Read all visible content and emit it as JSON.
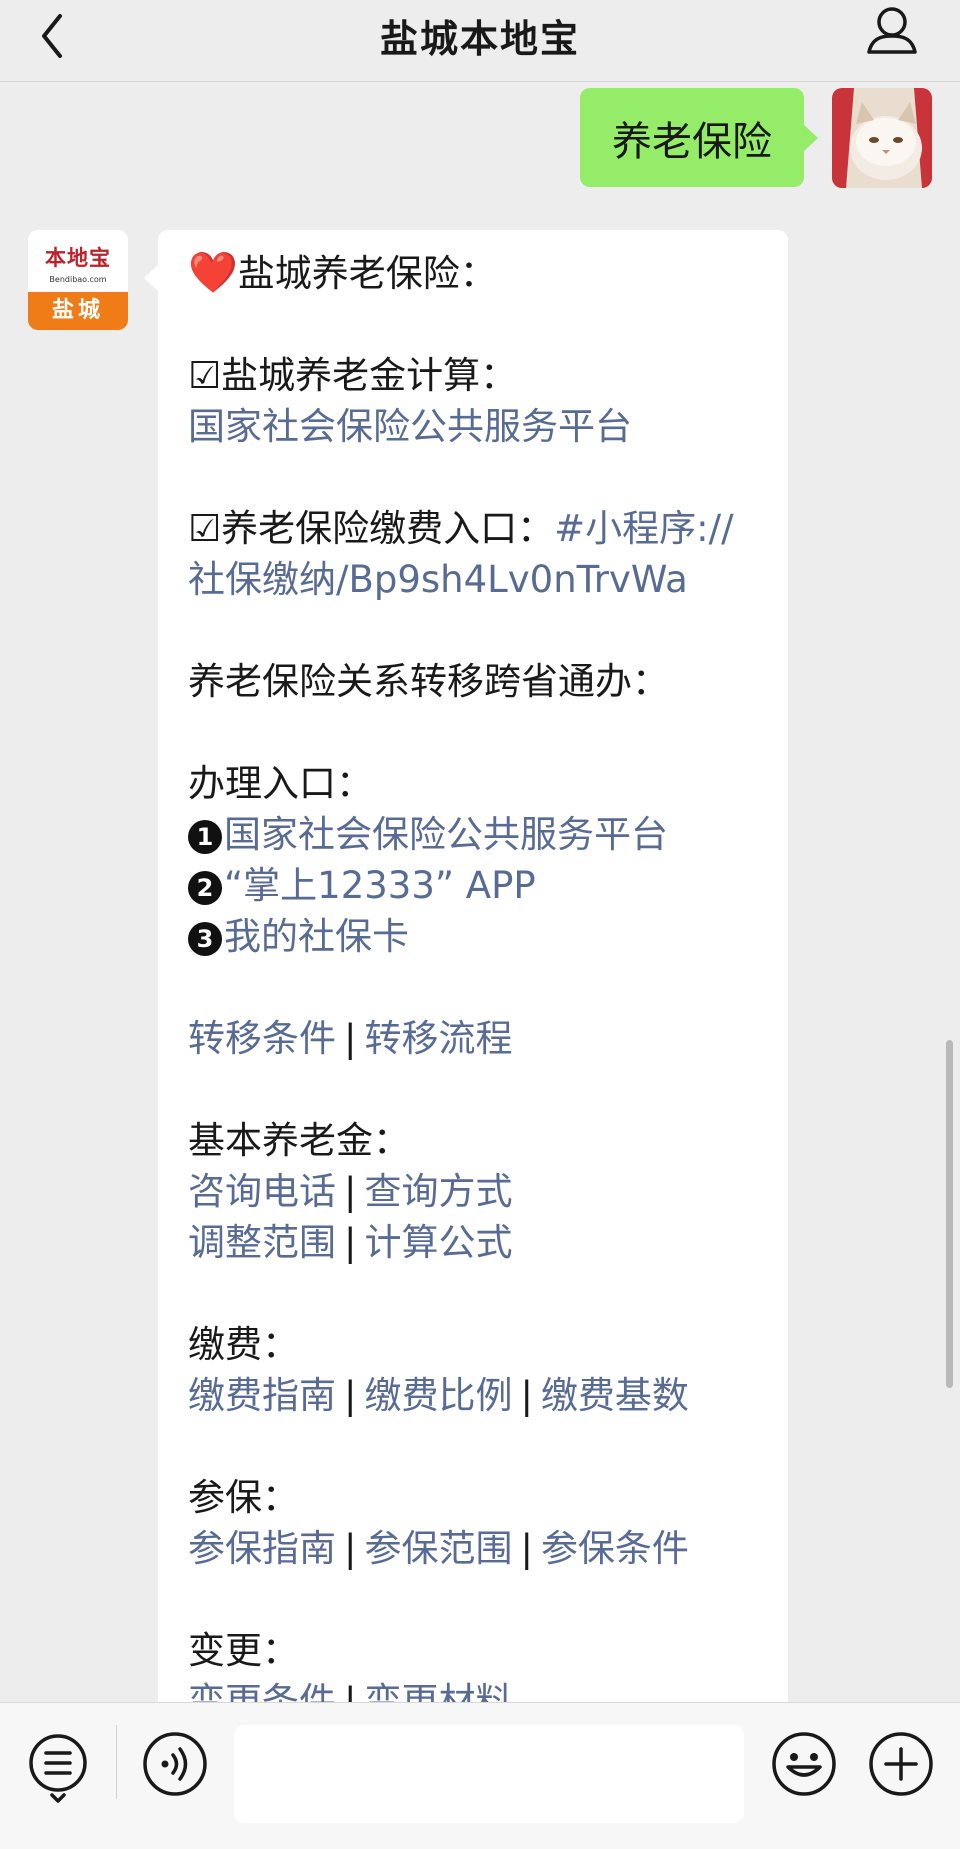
{
  "header": {
    "title": "盐城本地宝"
  },
  "outgoing": {
    "text": "养老保险"
  },
  "bot_avatar": {
    "brand": "本地宝",
    "url": "Bendibao.com",
    "city": "盐城"
  },
  "message": {
    "heading": "盐城养老保险：",
    "calc_label": "☑盐城养老金计算：",
    "calc_link": "国家社会保险公共服务平台",
    "pay_label": "☑养老保险缴费入口：",
    "pay_link_1": "#小程序://",
    "pay_link_2": "社保缴纳/Bp9sh4Lv0nTrvWa",
    "transfer_heading": "养老保险关系转移跨省通办：",
    "entry_label": "办理入口：",
    "entries": [
      {
        "num": "1",
        "label": "国家社会保险公共服务平台"
      },
      {
        "num": "2",
        "label": "“掌上12333” APP"
      },
      {
        "num": "3",
        "label": "我的社保卡"
      }
    ],
    "transfer_links": [
      "转移条件",
      "转移流程"
    ],
    "basic_label": "基本养老金：",
    "basic_links_1": [
      "咨询电话",
      "查询方式"
    ],
    "basic_links_2": [
      "调整范围",
      "计算公式"
    ],
    "fee_label": "缴费：",
    "fee_links": [
      "缴费指南",
      "缴费比例",
      "缴费基数"
    ],
    "insured_label": "参保：",
    "insured_links": [
      "参保指南",
      "参保范围",
      "参保条件"
    ],
    "change_label": "变更：",
    "change_links": [
      "变更条件",
      "变更材料"
    ]
  },
  "colors": {
    "outgoing_bubble": "#95ec69",
    "link": "#576b95",
    "background": "#ededed"
  }
}
